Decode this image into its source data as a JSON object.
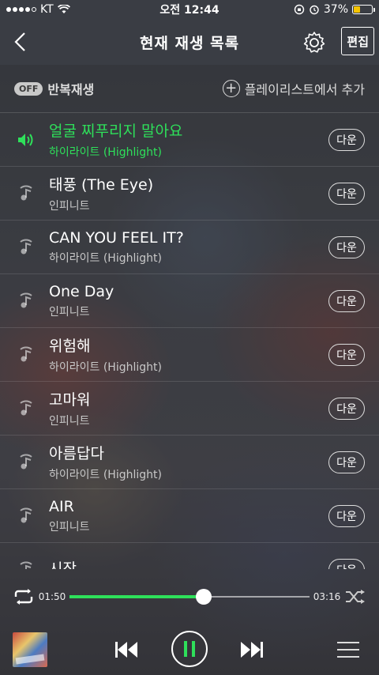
{
  "status_bar": {
    "carrier": "KT",
    "time": "오전 12:44",
    "battery": "37%",
    "battery_level": 0.37
  },
  "nav": {
    "title": "현재 재생 목록",
    "edit_label": "편집"
  },
  "options": {
    "repeat_badge": "OFF",
    "repeat_label": "반복재생",
    "add_playlist_label": "플레이리스트에서 추가"
  },
  "tracks": [
    {
      "title": "얼굴 찌푸리지 말아요",
      "artist": "하이라이트 (Highlight)",
      "down": "다운",
      "active": true
    },
    {
      "title": "태풍 (The Eye)",
      "artist": "인피니트",
      "down": "다운"
    },
    {
      "title": "CAN YOU FEEL IT?",
      "artist": "하이라이트 (Highlight)",
      "down": "다운"
    },
    {
      "title": "One Day",
      "artist": "인피니트",
      "down": "다운"
    },
    {
      "title": "위험해",
      "artist": "하이라이트 (Highlight)",
      "down": "다운"
    },
    {
      "title": "고마워",
      "artist": "인피니트",
      "down": "다운"
    },
    {
      "title": "아름답다",
      "artist": "하이라이트 (Highlight)",
      "down": "다운"
    },
    {
      "title": "AIR",
      "artist": "인피니트",
      "down": "다운"
    },
    {
      "title": "시작",
      "artist": "",
      "down": "다운"
    }
  ],
  "player": {
    "elapsed": "01:50",
    "total": "03:16",
    "progress": 0.56,
    "accent_color": "#2ee05a"
  }
}
